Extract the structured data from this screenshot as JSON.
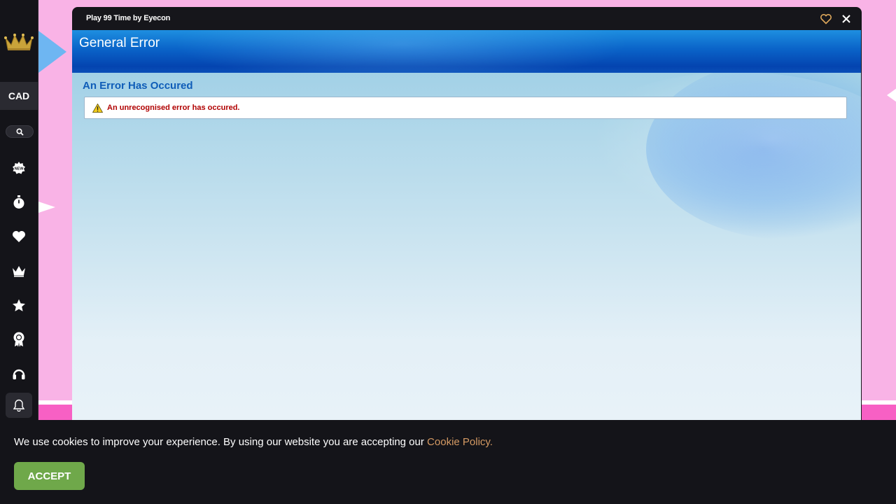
{
  "sidebar": {
    "currency": "CAD",
    "icons": [
      "crown-logo-icon",
      "search-icon",
      "new-badge-icon",
      "stopwatch-icon",
      "heart-icon",
      "crown-icon",
      "star-icon",
      "award-ribbon-icon",
      "headset-icon",
      "bell-icon"
    ]
  },
  "window": {
    "title": "Play 99 Time by Eyecon"
  },
  "game": {
    "header_title": "General Error",
    "error_heading": "An Error Has Occured",
    "error_message": "An unrecognised error has occured."
  },
  "cookie": {
    "text": "We use cookies to improve your experience. By using our website you are accepting our ",
    "link": "Cookie Policy.",
    "accept": "ACCEPT"
  },
  "colors": {
    "background_pink": "#f9b3e6",
    "sidebar": "#141419",
    "header_blue": "#0a63c8",
    "error_heading": "#0f5db8",
    "error_text": "#b00000",
    "accept_green": "#6fa84a",
    "link_orange": "#d59a63"
  }
}
